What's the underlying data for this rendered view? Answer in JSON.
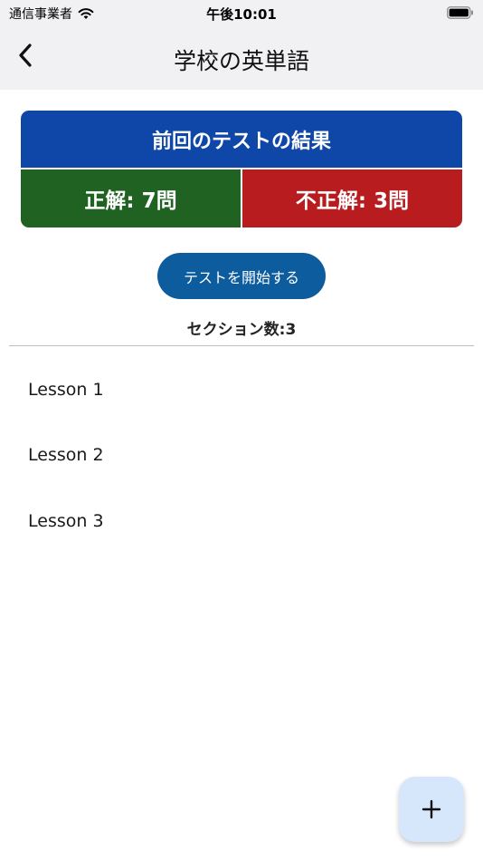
{
  "status_bar": {
    "carrier": "通信事業者",
    "time": "午後10:01",
    "icons": [
      "wifi-icon",
      "battery-icon"
    ]
  },
  "nav": {
    "title": "学校の英単語",
    "back_icon": "chevron-left-icon"
  },
  "results": {
    "header": "前回のテストの結果",
    "correct_label": "正解: 7問",
    "incorrect_label": "不正解: 3問",
    "correct_count": 7,
    "incorrect_count": 3
  },
  "actions": {
    "start_test_label": "テストを開始する"
  },
  "sections": {
    "count_label": "セクション数:3",
    "items": [
      {
        "label": "Lesson 1"
      },
      {
        "label": "Lesson 2"
      },
      {
        "label": "Lesson 3"
      }
    ]
  },
  "fab": {
    "icon": "plus-icon"
  },
  "colors": {
    "header_blue": "#0f47a8",
    "correct_green": "#1f6222",
    "incorrect_red": "#b81c1f",
    "button_blue": "#0d5c9e",
    "fab_bg": "#d6e6fb",
    "top_bar_bg": "#f1f1f3"
  }
}
